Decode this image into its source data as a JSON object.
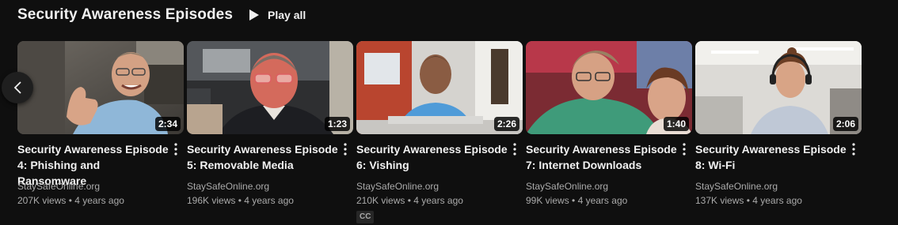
{
  "shelf": {
    "title": "Security Awareness Episodes",
    "play_all_label": "Play all"
  },
  "videos": [
    {
      "title": "Security Awareness Episode\n4: Phishing and Ransomware",
      "duration": "2:34",
      "channel": "StaySafeOnline.org",
      "views": "207K views",
      "age": "4 years ago"
    },
    {
      "title": "Security Awareness Episode\n5: Removable Media",
      "duration": "1:23",
      "channel": "StaySafeOnline.org",
      "views": "196K views",
      "age": "4 years ago"
    },
    {
      "title": "Security Awareness Episode\n6: Vishing",
      "duration": "2:26",
      "channel": "StaySafeOnline.org",
      "views": "210K views",
      "age": "4 years ago",
      "badge": "CC"
    },
    {
      "title": "Security Awareness Episode\n7: Internet Downloads",
      "duration": "1:40",
      "channel": "StaySafeOnline.org",
      "views": "99K views",
      "age": "4 years ago"
    },
    {
      "title": "Security Awareness Episode\n8: Wi-Fi",
      "duration": "2:06",
      "channel": "StaySafeOnline.org",
      "views": "137K views",
      "age": "4 years ago"
    }
  ],
  "stats_separator": " • ",
  "icons": {
    "play_all": "play-icon",
    "prev": "chevron-left-icon",
    "menu": "more-vert-icon"
  }
}
